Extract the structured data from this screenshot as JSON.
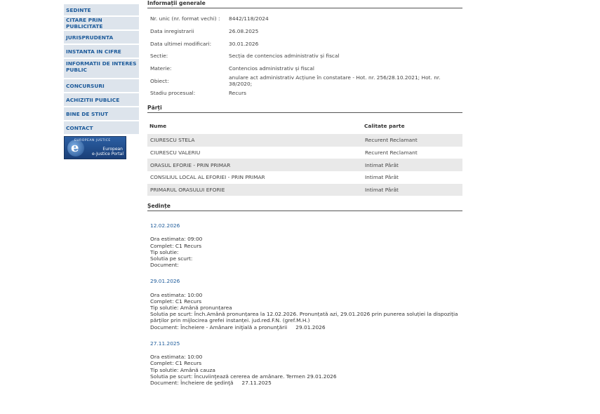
{
  "sidebar": {
    "items": [
      {
        "label": "SEDINTE"
      },
      {
        "label": "CITARE PRIN PUBLICITATE"
      },
      {
        "label": "JURISPRUDENTA"
      },
      {
        "label": "INSTANTA IN CIFRE"
      },
      {
        "label": "INFORMATII DE INTERES PUBLIC"
      },
      {
        "label": "CONCURSURI"
      },
      {
        "label": "ACHIZITII PUBLICE"
      },
      {
        "label": "BINE DE STIUT"
      },
      {
        "label": "CONTACT"
      }
    ],
    "banner": {
      "top_text": "EUROPEAN JUSTICE",
      "line1": "European",
      "line2": "e-Justice Portal"
    }
  },
  "general": {
    "title": "Informații generale",
    "rows": [
      {
        "label": "Nr. unic (nr. format vechi) :",
        "value": "8442/118/2024"
      },
      {
        "label": "Data inregistrarii",
        "value": "26.08.2025"
      },
      {
        "label": "Data ultimei modificari:",
        "value": "30.01.2026"
      },
      {
        "label": "Sectie:",
        "value": "Secția de contencios administrativ și fiscal"
      },
      {
        "label": "Materie:",
        "value": "Contencios administrativ și fiscal"
      },
      {
        "label": "Obiect:",
        "value": "anulare act administrativ Acțiune în constatare - Hot. nr. 256/28.10.2021; Hot. nr. 38/2020;"
      },
      {
        "label": "Stadiu procesual:",
        "value": "Recurs"
      }
    ]
  },
  "parti": {
    "title": "Părți",
    "headers": {
      "name": "Nume",
      "role": "Calitate parte"
    },
    "rows": [
      {
        "name": "CIURESCU STELA",
        "role": "Recurent Reclamant"
      },
      {
        "name": "CIURESCU VALERIU",
        "role": "Recurent Reclamant"
      },
      {
        "name": "ORASUL EFORIE - PRIN PRIMAR",
        "role": "Intimat Pârât"
      },
      {
        "name": "CONSILIUL LOCAL AL EFORIEI - PRIN PRIMAR",
        "role": "Intimat Pârât"
      },
      {
        "name": "PRIMARUL ORASULUI EFORIE",
        "role": "Intimat Pârât"
      }
    ]
  },
  "sedinte": {
    "title": "Ședințe",
    "items": [
      {
        "date": "12.02.2026",
        "ora": "Ora estimata: 09:00",
        "complet": "Complet: C1 Recurs",
        "tip": "Tip solutie:",
        "solutie": "Solutia pe scurt:",
        "document": "Document:",
        "doc_date": ""
      },
      {
        "date": "29.01.2026",
        "ora": "Ora estimata: 10:00",
        "complet": "Complet: C1 Recurs",
        "tip": "Tip solutie: Amână pronunțarea",
        "solutie": "Solutia pe scurt: Înch.Amână pronunțarea la 12.02.2026. Pronunțată azi, 29.01.2026 prin punerea soluției la dispoziția părților prin mijlocirea grefei instanței. jud.red.F.N. (gref.M.H.)",
        "document": "Document: Încheiere - Amânare iniţială a pronunţării",
        "doc_date": "29.01.2026"
      },
      {
        "date": "27.11.2025",
        "ora": "Ora estimata: 10:00",
        "complet": "Complet: C1 Recurs",
        "tip": "Tip solutie: Amână cauza",
        "solutie": "Solutia pe scurt: Încuviinţează cererea de amânare. Termen 29.01.2026",
        "document": "Document: Încheiere de şedinţă",
        "doc_date": "27.11.2025"
      }
    ]
  }
}
